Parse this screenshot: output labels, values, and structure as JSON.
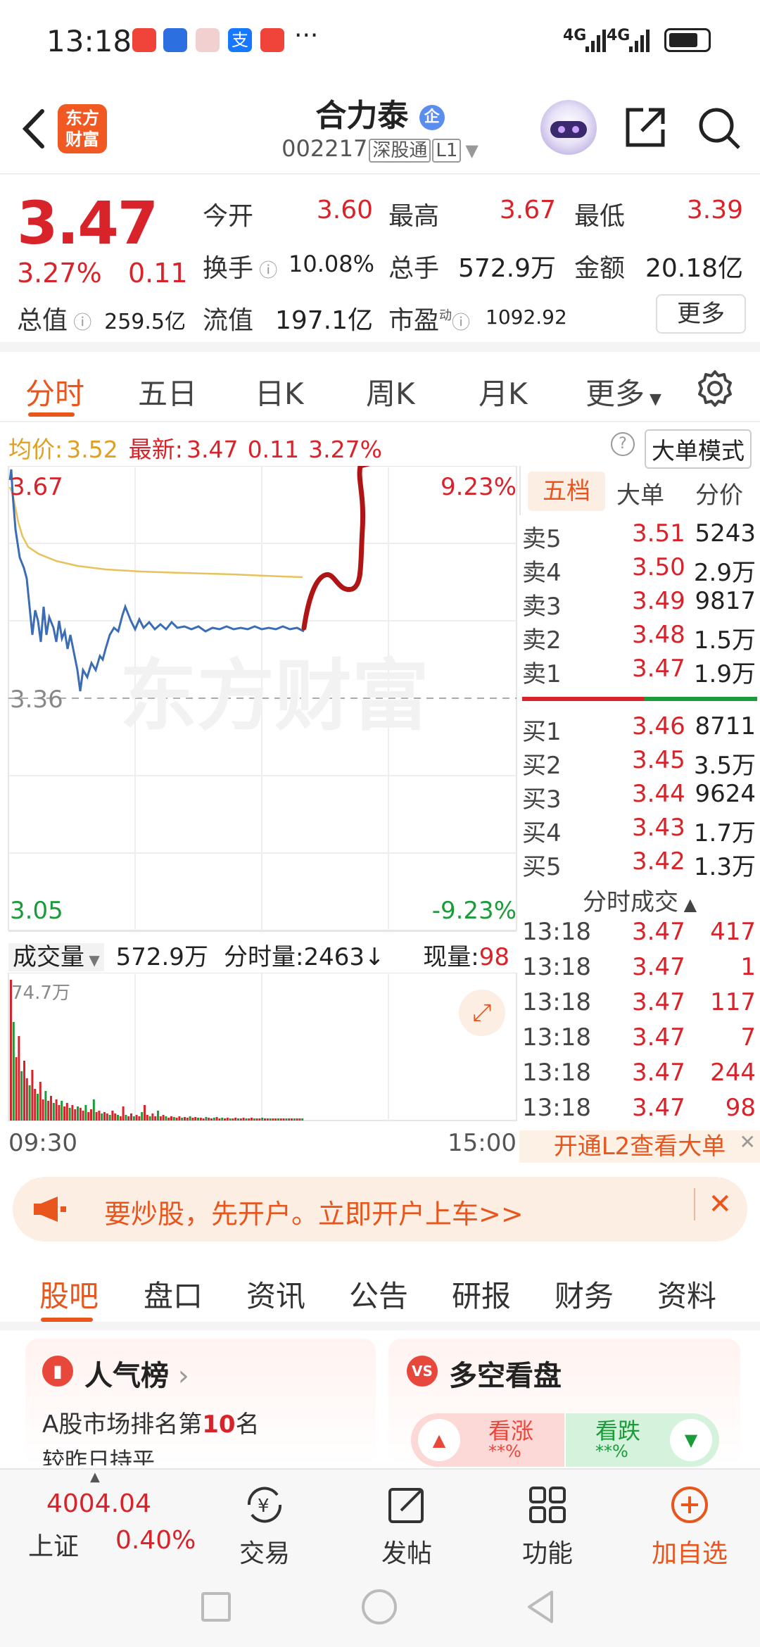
{
  "status": {
    "time": "13:18",
    "signal1": "4G",
    "signal2": "4G",
    "more": "···"
  },
  "header": {
    "title": "合力泰",
    "badge": "企",
    "code": "002217",
    "market_tag": "深股通",
    "level_tag": "L1",
    "logo_line1": "东方",
    "logo_line2": "财富"
  },
  "quote": {
    "price": "3.47",
    "change_pct": "3.27%",
    "change": "0.11",
    "open_label": "今开",
    "open": "3.60",
    "high_label": "最高",
    "high": "3.67",
    "low_label": "最低",
    "low": "3.39",
    "turnover_label": "换手",
    "turnover": "10.08%",
    "volume_label": "总手",
    "volume": "572.9万",
    "amount_label": "金额",
    "amount": "20.18亿",
    "mcap_label": "总值",
    "mcap": "259.5亿",
    "float_label": "流值",
    "float": "197.1亿",
    "pe_label": "市盈",
    "pe_sup": "动",
    "pe": "1092.92",
    "more": "更多"
  },
  "chart_tabs": [
    "分时",
    "五日",
    "日K",
    "周K",
    "月K",
    "更多"
  ],
  "avgbar": {
    "avg_label": "均价:",
    "avg": "3.52",
    "latest_label": "最新:",
    "latest": "3.47",
    "chg": "0.11",
    "pct": "3.27%",
    "mode": "大单模式"
  },
  "chart": {
    "top_price": "3.67",
    "top_pct": "9.23%",
    "mid_price": "3.36",
    "bottom_price": "3.05",
    "bottom_pct": "-9.23%",
    "watermark": "东方财富",
    "time_start": "09:30",
    "time_end": "15:00"
  },
  "volbar": {
    "label": "成交量",
    "total": "572.9万",
    "tick_label": "分时量:2463",
    "now_label": "现量:",
    "now": "98",
    "max": "74.7万"
  },
  "depth": {
    "tabs": [
      "五档",
      "大单",
      "分价"
    ],
    "sells": [
      {
        "label": "卖5",
        "price": "3.51",
        "qty": "5243"
      },
      {
        "label": "卖4",
        "price": "3.50",
        "qty": "2.9万"
      },
      {
        "label": "卖3",
        "price": "3.49",
        "qty": "9817"
      },
      {
        "label": "卖2",
        "price": "3.48",
        "qty": "1.5万"
      },
      {
        "label": "卖1",
        "price": "3.47",
        "qty": "1.9万"
      }
    ],
    "buys": [
      {
        "label": "买1",
        "price": "3.46",
        "qty": "8711"
      },
      {
        "label": "买2",
        "price": "3.45",
        "qty": "3.5万"
      },
      {
        "label": "买3",
        "price": "3.44",
        "qty": "9624"
      },
      {
        "label": "买4",
        "price": "3.43",
        "qty": "1.7万"
      },
      {
        "label": "买5",
        "price": "3.42",
        "qty": "1.3万"
      }
    ],
    "ticks_title": "分时成交",
    "ticks": [
      {
        "time": "13:18",
        "price": "3.47",
        "qty": "417"
      },
      {
        "time": "13:18",
        "price": "3.47",
        "qty": "1"
      },
      {
        "time": "13:18",
        "price": "3.47",
        "qty": "117"
      },
      {
        "time": "13:18",
        "price": "3.47",
        "qty": "7"
      },
      {
        "time": "13:18",
        "price": "3.47",
        "qty": "244"
      },
      {
        "time": "13:18",
        "price": "3.47",
        "qty": "98"
      }
    ],
    "l2": "开通L2查看大单"
  },
  "banner": {
    "text": "要炒股，先开户。立即开户上车>>"
  },
  "bottom_tabs": [
    "股吧",
    "盘口",
    "资讯",
    "公告",
    "研报",
    "财务",
    "资料"
  ],
  "cards": {
    "popular_title": "人气榜",
    "popular_line1": "A股市场排名第",
    "popular_rank": "10",
    "popular_unit": "名",
    "popular_line2": "较昨日持平",
    "bull_title": "多空看盘",
    "bull_up": "看涨",
    "bull_up_val": "**%",
    "bull_down": "看跌",
    "bull_down_val": "**%"
  },
  "nav": {
    "index_value": "4004.04",
    "index_name": "上证",
    "index_pct": "0.40%",
    "trade": "交易",
    "post": "发帖",
    "func": "功能",
    "add": "加自选"
  },
  "colors": {
    "up": "#d8232a",
    "down": "#1a9c39",
    "accent": "#e8561e",
    "avg_line": "#e8c15a",
    "price_line": "#3a6db5"
  }
}
